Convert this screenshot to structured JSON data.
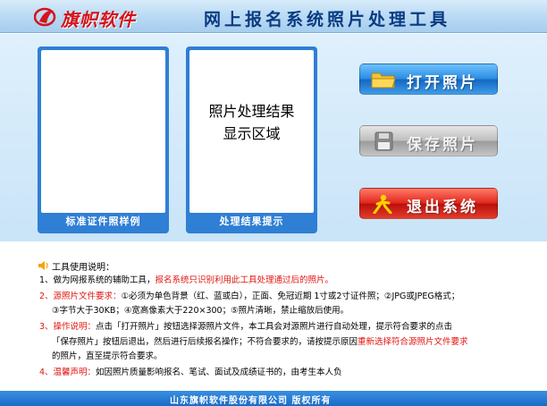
{
  "header": {
    "logo_text": "旗帜软件",
    "app_title": "网上报名系统照片处理工具"
  },
  "panels": {
    "sample_caption": "标准证件照样例",
    "result_caption": "处理结果提示",
    "result_placeholder_line1": "照片处理结果",
    "result_placeholder_line2": "显示区域"
  },
  "buttons": {
    "open_label": "打开照片",
    "save_label": "保存照片",
    "exit_label": "退出系统"
  },
  "instructions": {
    "title": "工具使用说明：",
    "item1_prefix": "1、做为网报系统的辅助工具，",
    "item1_red": "报名系统只识别利用此工具处理通过后的照片。",
    "item2_label": "2、源照片文件要求：",
    "item2_text": "①必须为单色背景（红、蓝或白），正面、免冠近期 1寸或2寸证件照；②JPG或JPEG格式；",
    "item2_text_b": "③字节大于30KB；④宽高像素大于220×300；⑤照片清晰，禁止缩放后使用。",
    "item3_label": "3、操作说明：",
    "item3_text": "点击「打开照片」按钮选择源照片文件，本工具会对源照片进行自动处理，提示符合要求的点击",
    "item3_text_b": "「保存照片」按钮后退出，然后进行后续报名操作；不符合要求的，请按提示原因",
    "item3_red_b": "重新选择符合源照片文件要求",
    "item3_text_c": "的照片，直至提示符合要求。",
    "item4_label": "4、温馨声明：",
    "item4_text": "如因照片质量影响报名、笔试、面试及成绩证书的，由考生本人负"
  },
  "footer": {
    "text": "山东旗帜软件股份有限公司  版权所有"
  }
}
